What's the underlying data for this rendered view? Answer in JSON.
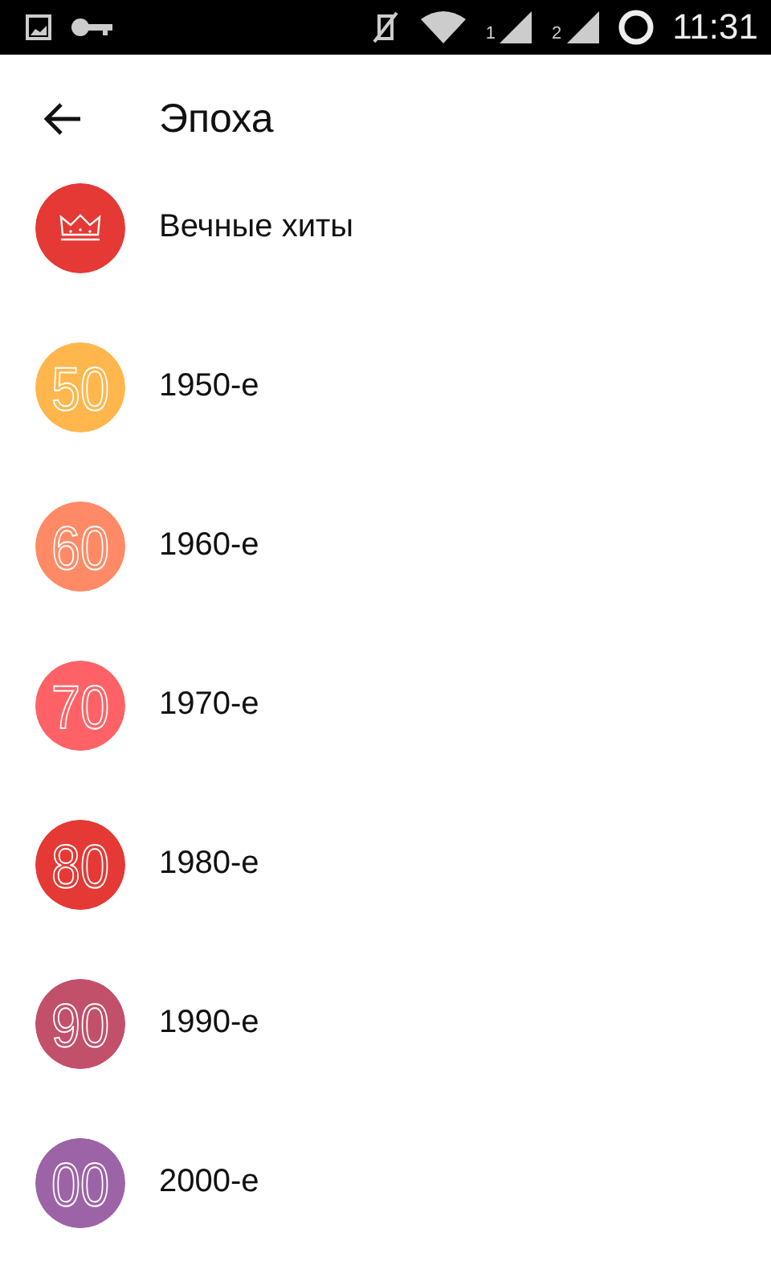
{
  "status_bar": {
    "sim_1": "1",
    "sim_2": "2",
    "time": "11:31"
  },
  "header": {
    "title": "Эпоха"
  },
  "items": [
    {
      "kind": "crown",
      "label": "Вечные хиты",
      "color": "#e53935"
    },
    {
      "kind": "number",
      "badge": "50",
      "label": "1950-е",
      "color": "#ffb74d"
    },
    {
      "kind": "number",
      "badge": "60",
      "label": "1960-е",
      "color": "#ff8a65"
    },
    {
      "kind": "number",
      "badge": "70",
      "label": "1970-е",
      "color": "#ff6266"
    },
    {
      "kind": "number",
      "badge": "80",
      "label": "1980-е",
      "color": "#e53935"
    },
    {
      "kind": "number",
      "badge": "90",
      "label": "1990-е",
      "color": "#c2506a"
    },
    {
      "kind": "number",
      "badge": "00",
      "label": "2000-е",
      "color": "#9c64a6"
    }
  ]
}
